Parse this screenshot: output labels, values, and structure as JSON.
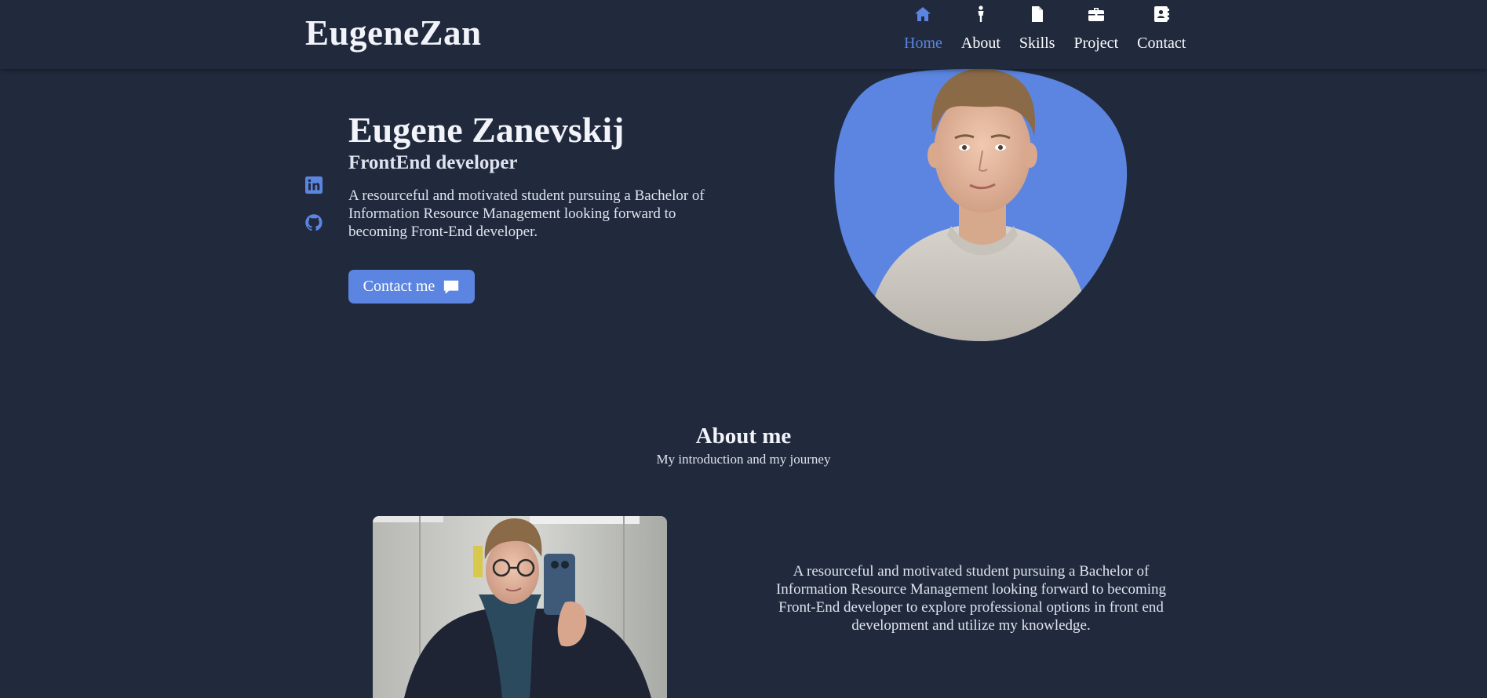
{
  "brand": {
    "logo": "EugeneZan",
    "accent_color": "#5b85e0",
    "background_color": "#212a3d"
  },
  "nav": {
    "items": [
      {
        "label": "Home",
        "icon": "home-icon",
        "active": true
      },
      {
        "label": "About",
        "icon": "person-icon",
        "active": false
      },
      {
        "label": "Skills",
        "icon": "file-icon",
        "active": false
      },
      {
        "label": "Project",
        "icon": "briefcase-icon",
        "active": false
      },
      {
        "label": "Contact",
        "icon": "contact-book-icon",
        "active": false
      }
    ]
  },
  "social": {
    "items": [
      {
        "name": "LinkedIn",
        "icon": "linkedin-icon"
      },
      {
        "name": "GitHub",
        "icon": "github-icon"
      }
    ]
  },
  "hero": {
    "title": "Eugene Zanevskij",
    "subtitle": "FrontEnd developer",
    "description": "A resourceful and motivated student pursuing a Bachelor of Information Resource Management looking forward to becoming Front-End developer.",
    "button_label": "Contact me",
    "button_icon": "chat-bubble-icon",
    "image": "profile-photo"
  },
  "about": {
    "title": "About me",
    "subtitle": "My introduction and my journey",
    "image": "about-photo",
    "description": "A resourceful and motivated student pursuing a Bachelor of Information Resource Management looking forward to becoming Front-End developer to explore professional options in front end development and utilize my knowledge."
  }
}
